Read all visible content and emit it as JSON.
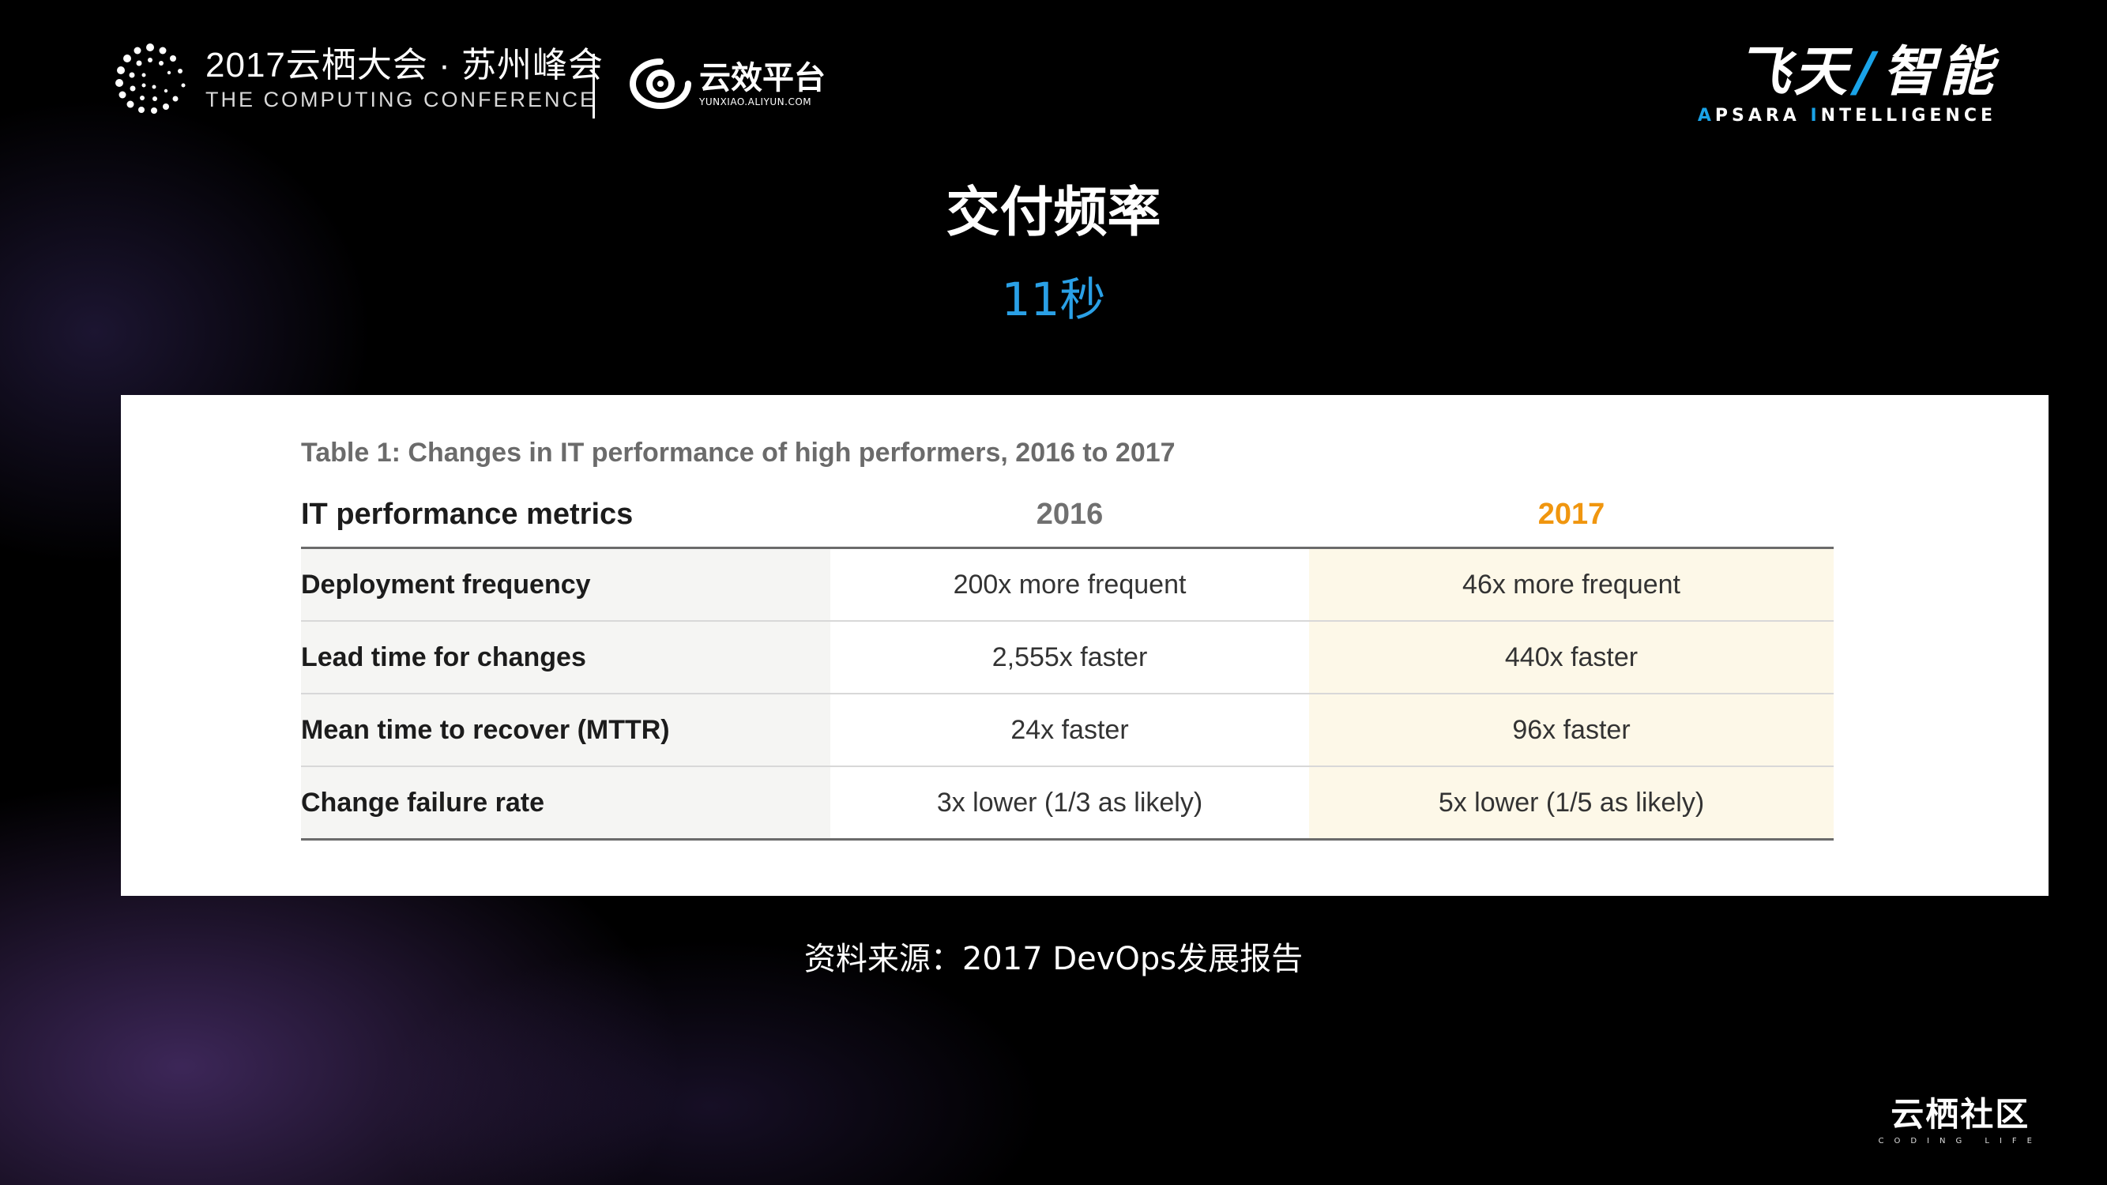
{
  "header": {
    "conference_title": "2017云栖大会 · 苏州峰会",
    "conference_subtitle": "THE COMPUTING CONFERENCE",
    "platform_name": "云效平台",
    "platform_url": "YUNXIAO.ALIYUN.COM",
    "brand_cn_left": "飞天",
    "brand_cn_slash": "/",
    "brand_cn_right": "智能",
    "brand_en_a": "A",
    "brand_en_psara": "PSARA ",
    "brand_en_i": "I",
    "brand_en_ntelligence": "NTELLIGENCE"
  },
  "slide": {
    "title": "交付频率",
    "subtitle": "11秒",
    "source": "资料来源：2017 DevOps发展报告"
  },
  "table": {
    "caption": "Table 1: Changes in IT performance of high performers, 2016 to 2017",
    "headers": [
      "IT performance metrics",
      "2016",
      "2017"
    ],
    "rows": [
      [
        "Deployment frequency",
        "200x more frequent",
        "46x more frequent"
      ],
      [
        "Lead time for changes",
        "2,555x faster",
        "440x faster"
      ],
      [
        "Mean time to recover (MTTR)",
        "24x faster",
        "96x faster"
      ],
      [
        "Change failure rate",
        "3x lower (1/3 as likely)",
        "5x lower (1/5 as likely)"
      ]
    ]
  },
  "footer": {
    "community_cn": "云栖社区",
    "community_en": "CODING LIFE"
  },
  "colors": {
    "accent_blue": "#2aa0e6",
    "year_2017_orange": "#f0960f",
    "column_2017_bg": "#fdf8e8"
  }
}
